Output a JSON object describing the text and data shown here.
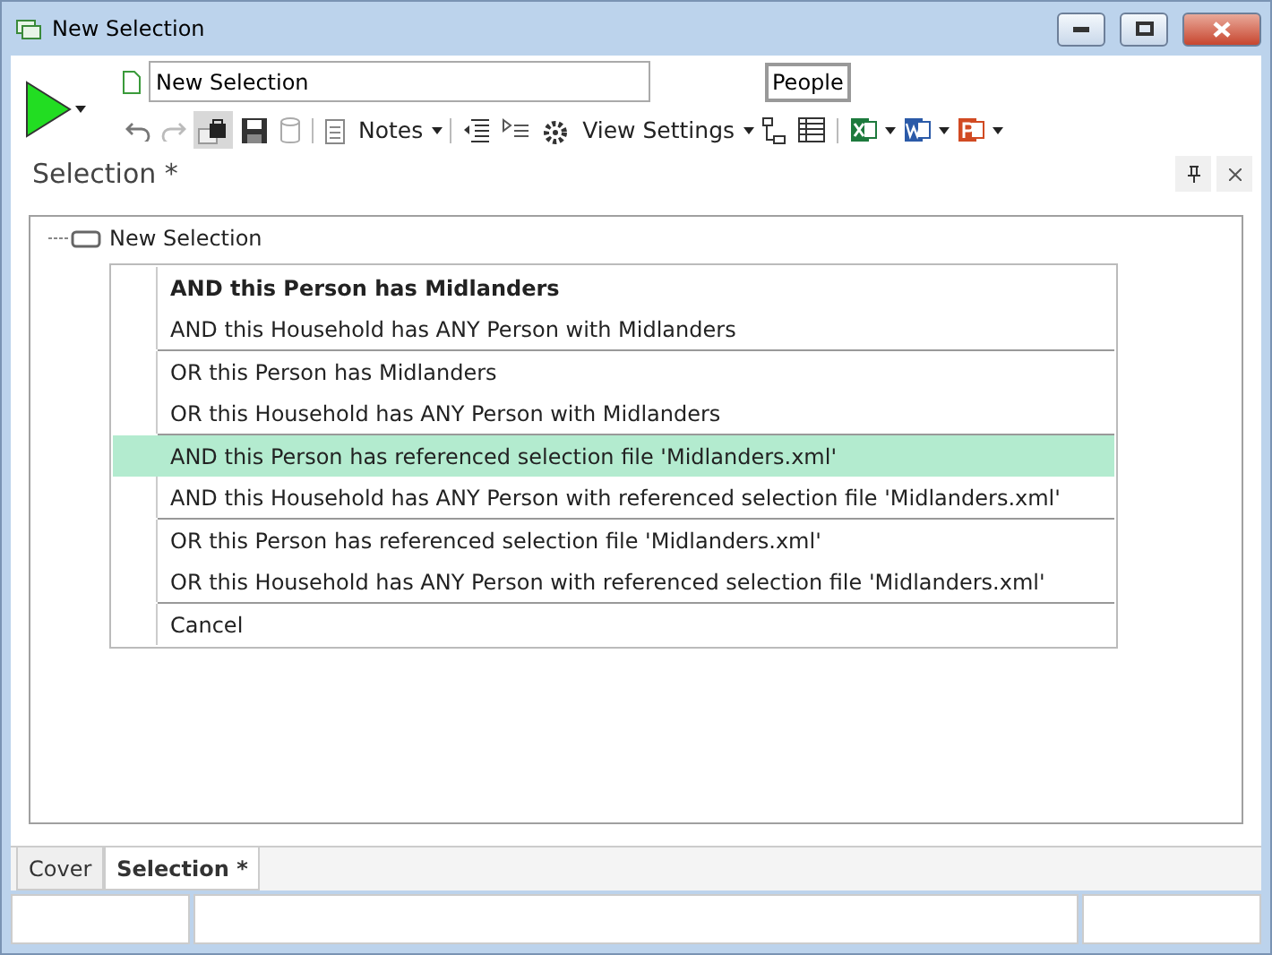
{
  "window": {
    "title": "New Selection"
  },
  "selection_name": {
    "value": "New Selection"
  },
  "people_button": "People",
  "toolbar": {
    "notes": "Notes",
    "view_settings": "View Settings",
    "undo_disabled": false,
    "redo_disabled": true
  },
  "panel": {
    "title": "Selection *"
  },
  "tree": {
    "root": "New Selection"
  },
  "menu": {
    "groups": [
      {
        "items": [
          {
            "label": "AND this Person has Midlanders",
            "bold": true,
            "selected": false
          },
          {
            "label": "AND this Household has ANY Person with Midlanders",
            "bold": false,
            "selected": false
          }
        ]
      },
      {
        "items": [
          {
            "label": "OR this Person has Midlanders",
            "bold": false,
            "selected": false
          },
          {
            "label": "OR this Household has ANY Person with Midlanders",
            "bold": false,
            "selected": false
          }
        ]
      },
      {
        "items": [
          {
            "label": "AND this Person has referenced selection file 'Midlanders.xml'",
            "bold": false,
            "selected": true
          },
          {
            "label": "AND this Household has ANY Person with referenced selection file 'Midlanders.xml'",
            "bold": false,
            "selected": false
          }
        ]
      },
      {
        "items": [
          {
            "label": "OR this Person has referenced selection file 'Midlanders.xml'",
            "bold": false,
            "selected": false
          },
          {
            "label": "OR this Household has ANY Person with referenced selection file 'Midlanders.xml'",
            "bold": false,
            "selected": false
          }
        ]
      },
      {
        "items": [
          {
            "label": "Cancel",
            "bold": false,
            "selected": false
          }
        ]
      }
    ]
  },
  "tabs": [
    {
      "label": "Cover",
      "selected": false
    },
    {
      "label": "Selection *",
      "selected": true
    }
  ]
}
